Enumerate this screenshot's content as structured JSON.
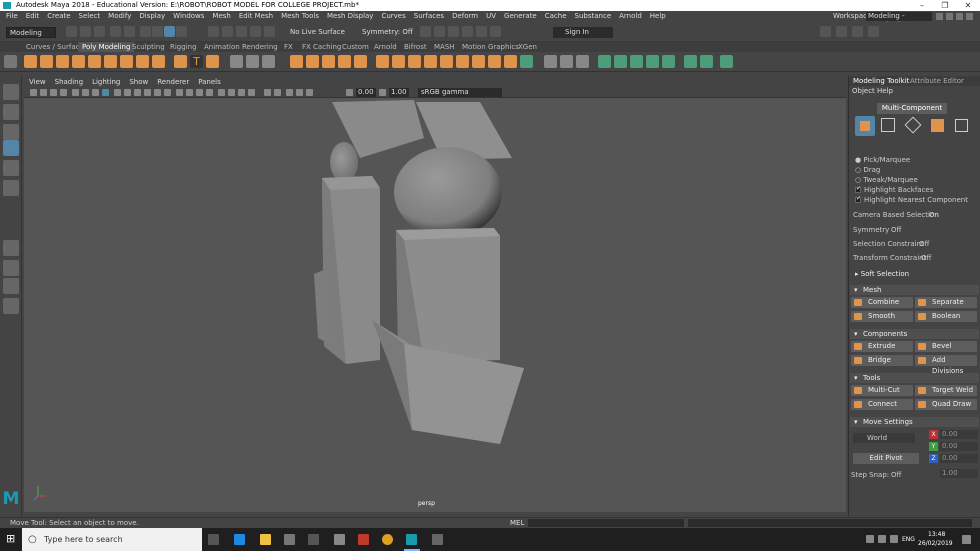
{
  "window": {
    "title": "Autodesk Maya 2018 - Educational Version: E:\\ROBOT\\ROBOT MODEL FOR COLLEGE PROJECT.mb*",
    "minimize": "–",
    "maximize": "❐",
    "close": "✕"
  },
  "menubar": {
    "items": [
      "File",
      "Edit",
      "Create",
      "Select",
      "Modify",
      "Display",
      "Windows",
      "Mesh",
      "Edit Mesh",
      "Mesh Tools",
      "Mesh Display",
      "Curves",
      "Surfaces",
      "Deform",
      "UV",
      "Generate",
      "Cache",
      "Substance",
      "Arnold",
      "Help"
    ],
    "workspace_label": "Workspace :",
    "workspace_value": "Modeling - Standard"
  },
  "statusline": {
    "mode": "Modeling",
    "live_surface": "No Live Surface",
    "symmetry": "Symmetry: Off",
    "sign_in": "Sign In"
  },
  "shelf": {
    "tabs": [
      "Curves / Surfaces",
      "Poly Modeling",
      "Sculpting",
      "Rigging",
      "Animation",
      "Rendering",
      "FX",
      "FX Caching",
      "Custom",
      "Arnold",
      "Bifrost",
      "MASH",
      "Motion Graphics",
      "XGen"
    ],
    "active_tab": "Poly Modeling"
  },
  "viewport": {
    "menu": [
      "View",
      "Shading",
      "Lighting",
      "Show",
      "Renderer",
      "Panels"
    ],
    "field_a": "0.00",
    "field_b": "1.00",
    "color_space": "sRGB gamma",
    "camera": "persp"
  },
  "toolkit": {
    "tabs": [
      "Modeling Toolkit",
      "Attribute Editor"
    ],
    "menu": [
      "Object",
      "Help"
    ],
    "mode": "Multi-Component",
    "options": {
      "pick_marquee": "Pick/Marquee",
      "drag": "Drag",
      "tweak_marquee": "Tweak/Marquee",
      "highlight_backfaces": "Highlight Backfaces",
      "highlight_nearest": "Highlight Nearest Component"
    },
    "camera_based_selection": "Camera Based Selection",
    "camera_based_value": "On",
    "symmetry": "Symmetry",
    "symmetry_value": "Off",
    "selection_constraint": "Selection Constraint",
    "selection_constraint_value": "Off",
    "transform_constraint": "Transform Constraint",
    "transform_constraint_value": "Off",
    "soft_selection": "Soft Selection",
    "sections": {
      "mesh": "Mesh",
      "components": "Components",
      "tools": "Tools",
      "move_settings": "Move Settings"
    },
    "buttons": {
      "combine": "Combine",
      "separate": "Separate",
      "smooth": "Smooth",
      "boolean": "Boolean",
      "extrude": "Extrude",
      "bevel": "Bevel",
      "bridge": "Bridge",
      "add_divisions": "Add Divisions",
      "multi_cut": "Multi-Cut",
      "target_weld": "Target Weld",
      "connect": "Connect",
      "quad_draw": "Quad Draw"
    },
    "move": {
      "space": "World",
      "edit_pivot": "Edit Pivot",
      "x": "X",
      "y": "Y",
      "z": "Z",
      "x_val": "0.00",
      "y_val": "0.00",
      "z_val": "0.00",
      "step_snap": "Step Snap:",
      "step_snap_value": "Off",
      "step_value": "1.00"
    }
  },
  "helpline": {
    "text": "Move Tool: Select an object to move.",
    "mel_label": "MEL"
  },
  "taskbar": {
    "search_placeholder": "Type here to search",
    "time": "13:48",
    "date": "26/02/2019",
    "lang": "ENG"
  },
  "colors": {
    "accent_orange": "#e0944a",
    "active_blue": "#5285a6",
    "green_icons": "#4d9d7a"
  }
}
